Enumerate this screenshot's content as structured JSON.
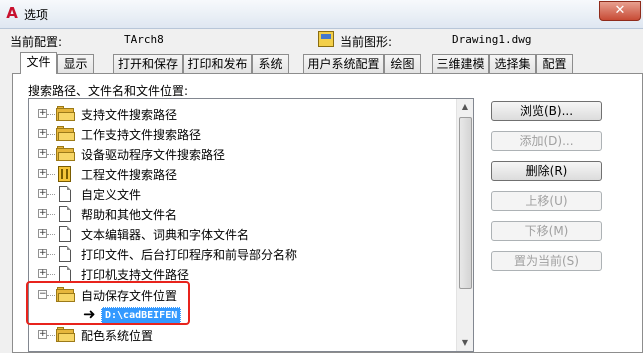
{
  "window": {
    "title": "选项",
    "close_glyph": "✕",
    "app_icon": "A"
  },
  "header": {
    "config_label": "当前配置:",
    "config_value": "TArch8",
    "drawing_label": "当前图形:",
    "drawing_value": "Drawing1.dwg"
  },
  "tabs": [
    "文件",
    "显示",
    "打开和保存",
    "打印和发布",
    "系统",
    "用户系统配置",
    "绘图",
    "三维建模",
    "选择集",
    "配置"
  ],
  "active_tab": "文件",
  "section_label": "搜索路径、文件名和文件位置:",
  "tree": {
    "items": [
      {
        "label": "支持文件搜索路径",
        "icon": "folder-icon"
      },
      {
        "label": "工作支持文件搜索路径",
        "icon": "folder-icon"
      },
      {
        "label": "设备驱动程序文件搜索路径",
        "icon": "folder-icon"
      },
      {
        "label": "工程文件搜索路径",
        "icon": "project-icon"
      },
      {
        "label": "自定义文件",
        "icon": "document-icon"
      },
      {
        "label": "帮助和其他文件名",
        "icon": "document-icon"
      },
      {
        "label": "文本编辑器、词典和字体文件名",
        "icon": "document-icon"
      },
      {
        "label": "打印文件、后台打印程序和前导部分名称",
        "icon": "document-icon"
      },
      {
        "label": "打印机支持文件路径",
        "icon": "document-icon"
      },
      {
        "label": "自动保存文件位置",
        "icon": "folder-icon",
        "expanded": true
      },
      {
        "label": "配色系统位置",
        "icon": "folder-icon"
      }
    ],
    "autosave_path": "D:\\cadBEIFEN",
    "child_arrow": "➜"
  },
  "buttons": {
    "browse": "浏览(B)...",
    "add": "添加(D)...",
    "remove": "删除(R)",
    "move_up": "上移(U)",
    "move_down": "下移(M)",
    "set_current": "置为当前(S)"
  }
}
